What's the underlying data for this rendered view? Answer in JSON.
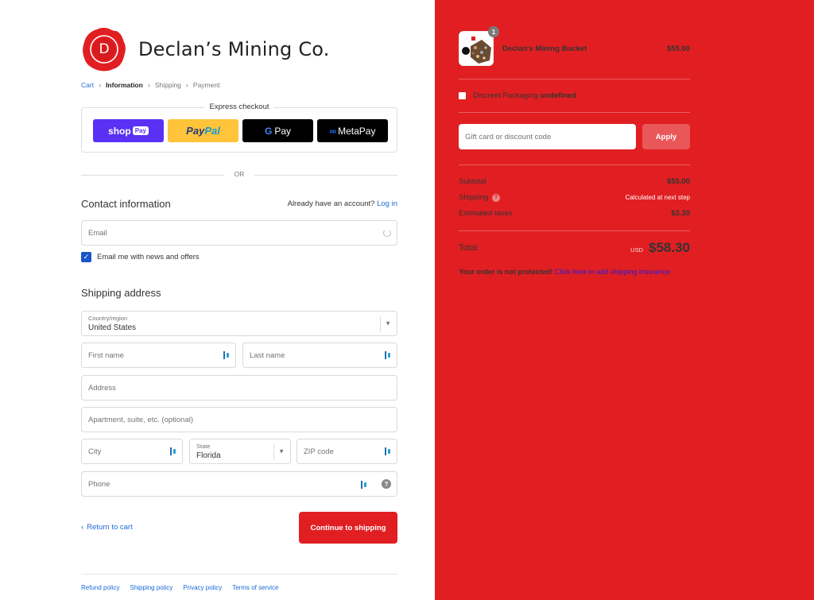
{
  "store": {
    "name": "Declan’s Mining Co.",
    "logo_letter": "D"
  },
  "breadcrumb": {
    "cart": "Cart",
    "information": "Information",
    "shipping": "Shipping",
    "payment": "Payment"
  },
  "express": {
    "title": "Express checkout",
    "shop_pay": {
      "shop": "shop",
      "pay": "Pay"
    },
    "paypal": {
      "pay": "Pay",
      "pal": "Pal"
    },
    "google_pay": {
      "g": "G",
      "pay": "Pay"
    },
    "meta_pay": {
      "meta": "Meta",
      "pay": "Pay"
    }
  },
  "divider": {
    "or": "OR"
  },
  "contact": {
    "heading": "Contact information",
    "account_prompt": "Already have an account?",
    "login": "Log in",
    "email_placeholder": "Email",
    "newsletter_label": "Email me with news and offers",
    "newsletter_checked": true
  },
  "shipping": {
    "heading": "Shipping address",
    "country_label": "Country/region",
    "country_value": "United States",
    "first_name": "First name",
    "last_name": "Last name",
    "address": "Address",
    "apartment": "Apartment, suite, etc. (optional)",
    "city": "City",
    "state_label": "State",
    "state_value": "Florida",
    "zip": "ZIP code",
    "phone": "Phone"
  },
  "actions": {
    "return": "Return to cart",
    "continue": "Continue to shipping"
  },
  "policies": [
    "Refund policy",
    "Shipping policy",
    "Privacy policy",
    "Terms of service"
  ],
  "summary": {
    "product": {
      "name": "Declan's Mining Bucket",
      "price": "$55.00",
      "quantity": "1"
    },
    "discreet": {
      "label": "Discreet Packaging",
      "value": "undefined"
    },
    "discount_placeholder": "Gift card or discount code",
    "apply": "Apply",
    "subtotal": {
      "label": "Subtotal",
      "value": "$55.00"
    },
    "shipping": {
      "label": "Shipping",
      "value": "Calculated at next step"
    },
    "taxes": {
      "label": "Estimated taxes",
      "value": "$3.30"
    },
    "total": {
      "label": "Total",
      "currency": "USD",
      "value": "$58.30"
    },
    "warning": {
      "bold": "Your order is not protected!",
      "link": "Click here to add shipping insurance"
    }
  },
  "colors": {
    "brand_red": "#e11f22",
    "link_blue": "#1a6ad6",
    "checkbox_blue": "#1a55c5"
  }
}
